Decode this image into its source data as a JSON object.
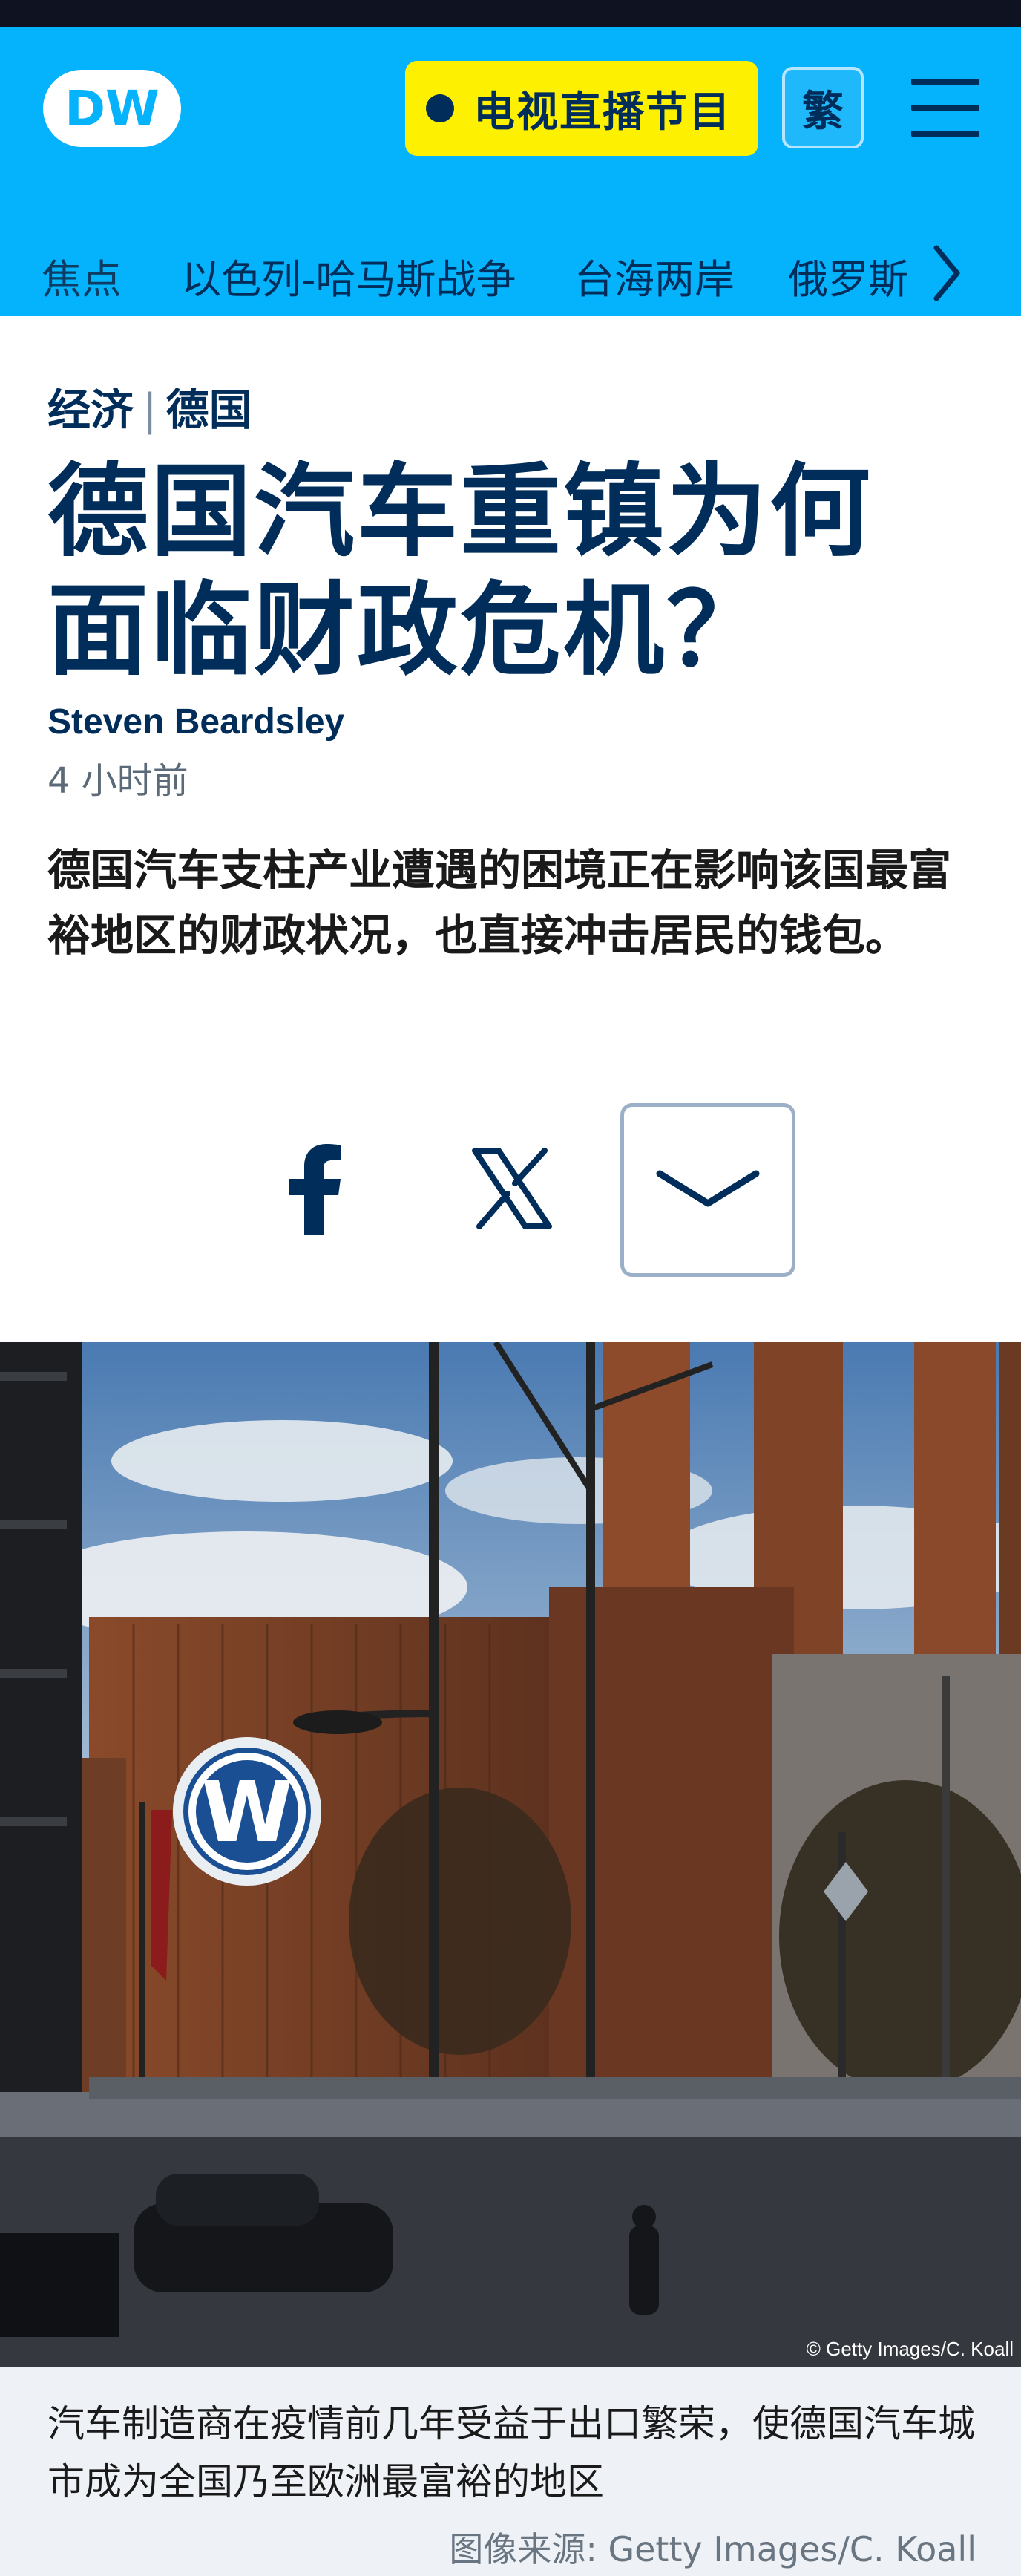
{
  "header": {
    "logo_text": "DW",
    "live_button_label": "电视直播节目",
    "lang_button_label": "繁",
    "menu_icon": "hamburger-menu-icon"
  },
  "nav": {
    "items": [
      {
        "label": "焦点"
      },
      {
        "label": "以色列-哈马斯战争"
      },
      {
        "label": "台海两岸"
      },
      {
        "label": "俄罗斯"
      }
    ],
    "more_icon": "chevron-right-icon"
  },
  "article": {
    "kicker": {
      "category": "经济",
      "separator": "|",
      "region": "德国"
    },
    "title": "德国汽车重镇为何面临财政危机？",
    "author": "Steven Beardsley",
    "time": "4 小时前",
    "summary": "德国汽车支柱产业遭遇的困境正在影响该国最富裕地区的财政状况，也直接冲击居民的钱包。"
  },
  "share": {
    "icons": [
      "facebook-icon",
      "x-icon",
      "chevron-down-icon"
    ]
  },
  "image": {
    "copyright": "© Getty Images/C. Koall",
    "caption": "汽车制造商在疫情前几年受益于出口繁荣，使德国汽车城市成为全国乃至欧洲最富裕的地区",
    "credit": "图像来源: Getty Images/C. Koall"
  },
  "colors": {
    "header_bg": "#05b2fc",
    "live_button_bg": "#fdf000",
    "brand_dark": "#002d5a",
    "caption_bg": "#eef2f6"
  }
}
